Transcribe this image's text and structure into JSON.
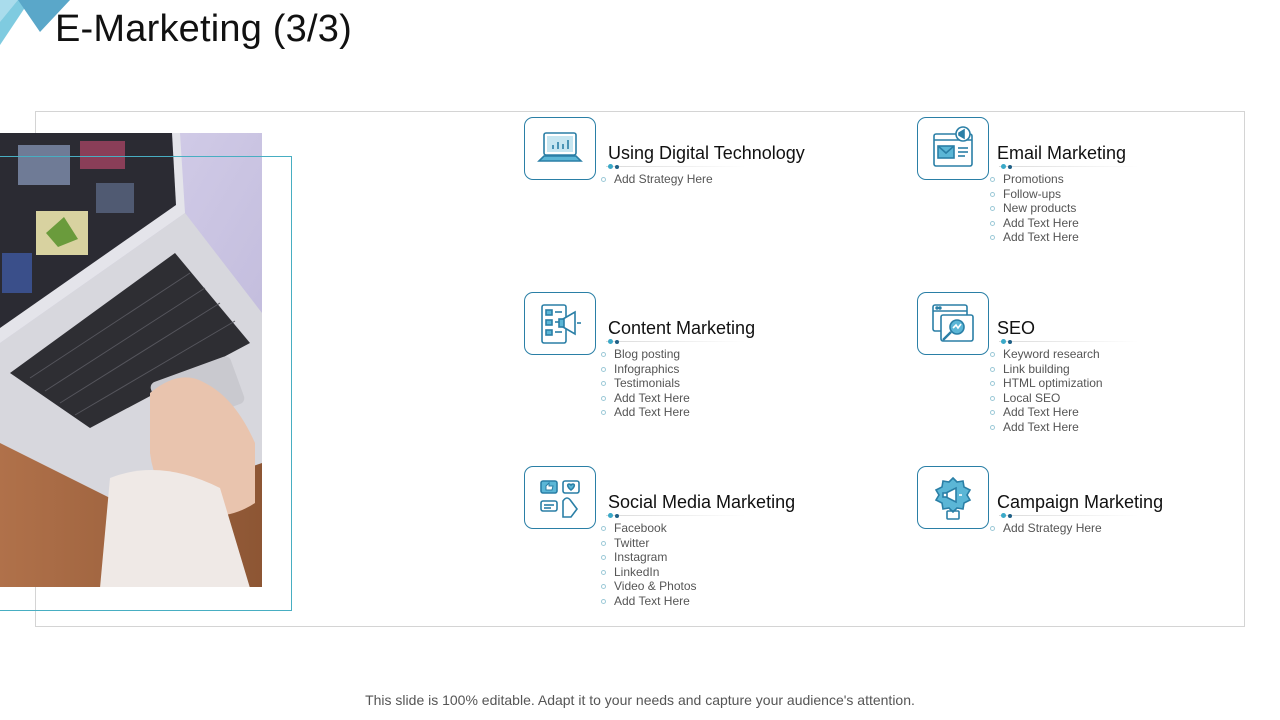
{
  "title": "E-Marketing (3/3)",
  "footer": "This slide is 100% editable. Adapt it to your needs and capture your audience's attention.",
  "colors": {
    "accent": "#3aa9c8",
    "icon_stroke": "#2a7fa6",
    "icon_fill": "#5bb6d6"
  },
  "items": [
    {
      "title": "Using Digital Technology",
      "icon": "laptop-chart-icon",
      "bullets": [
        "Add Strategy Here"
      ]
    },
    {
      "title": "Email Marketing",
      "icon": "email-megaphone-icon",
      "bullets": [
        "Promotions",
        "Follow-ups",
        "New products",
        "Add Text Here",
        "Add Text Here"
      ]
    },
    {
      "title": "Content Marketing",
      "icon": "content-megaphone-icon",
      "bullets": [
        "Blog posting",
        "Infographics",
        "Testimonials",
        "Add Text Here",
        "Add Text Here"
      ]
    },
    {
      "title": "SEO",
      "icon": "seo-search-icon",
      "bullets": [
        "Keyword research",
        "Link building",
        "HTML optimization",
        "Local SEO",
        "Add Text Here",
        "Add Text Here"
      ]
    },
    {
      "title": "Social Media Marketing",
      "icon": "social-media-icon",
      "bullets": [
        "Facebook",
        "Twitter",
        "Instagram",
        "LinkedIn",
        "Video & Photos",
        "Add Text Here"
      ]
    },
    {
      "title": "Campaign Marketing",
      "icon": "campaign-badge-icon",
      "bullets": [
        "Add Strategy Here"
      ]
    }
  ]
}
